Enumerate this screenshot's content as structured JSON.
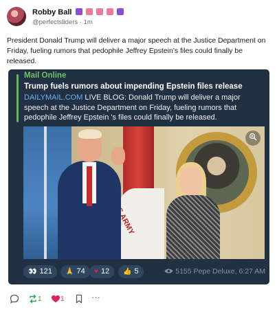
{
  "author": {
    "name": "Robby Ball",
    "handle": "@perfectsliders",
    "separator": "·",
    "time": "1m",
    "badge_colors": [
      "#8a4fd8",
      "#f07a9a",
      "#f07a9a",
      "#f07a9a",
      "#8a4fd8"
    ]
  },
  "post": {
    "text": "President Donald Trump will deliver a major speech at the Justice Department on Friday, fueling rumors that pedophile Jeffrey Epstein's files could finally be released."
  },
  "card": {
    "source": "Mail Online",
    "title": "Trump fuels rumors about impending Epstein files release",
    "link_text": "DAILYMAIL.COM",
    "body": " LIVE BLOG: Donald Trump will deliver a major speech at the Justice Department on Friday, fueling rumors that pedophile Jeffrey Epstein 's files could finally be released.",
    "photo_flag_text": "ES ARMY",
    "reactions": [
      {
        "icon": "eyes-emoji",
        "glyph": "👀",
        "count": "121"
      },
      {
        "icon": "pray-emoji",
        "glyph": "🙏",
        "count": "74"
      },
      {
        "icon": "heart-emoji",
        "glyph": "♥",
        "count": "12"
      },
      {
        "icon": "thumbs-up-emoji",
        "glyph": "👍",
        "count": "5"
      }
    ],
    "views": "5155",
    "signature": "Pepe Deluxe, 6:27 AM",
    "colors": {
      "background": "#223043",
      "accent": "#6cc267",
      "link": "#6ab3f3",
      "reaction_bg": "#2f4560"
    }
  },
  "actions": {
    "reply_icon": "comment-icon",
    "repost_icon": "repost-icon",
    "repost_count": "1",
    "repost_color": "#2aa74a",
    "like_icon": "heart-icon",
    "like_count": "1",
    "like_color": "#e0245e",
    "bookmark_icon": "bookmark-icon",
    "more_icon": "more-icon",
    "more_glyph": "···"
  }
}
